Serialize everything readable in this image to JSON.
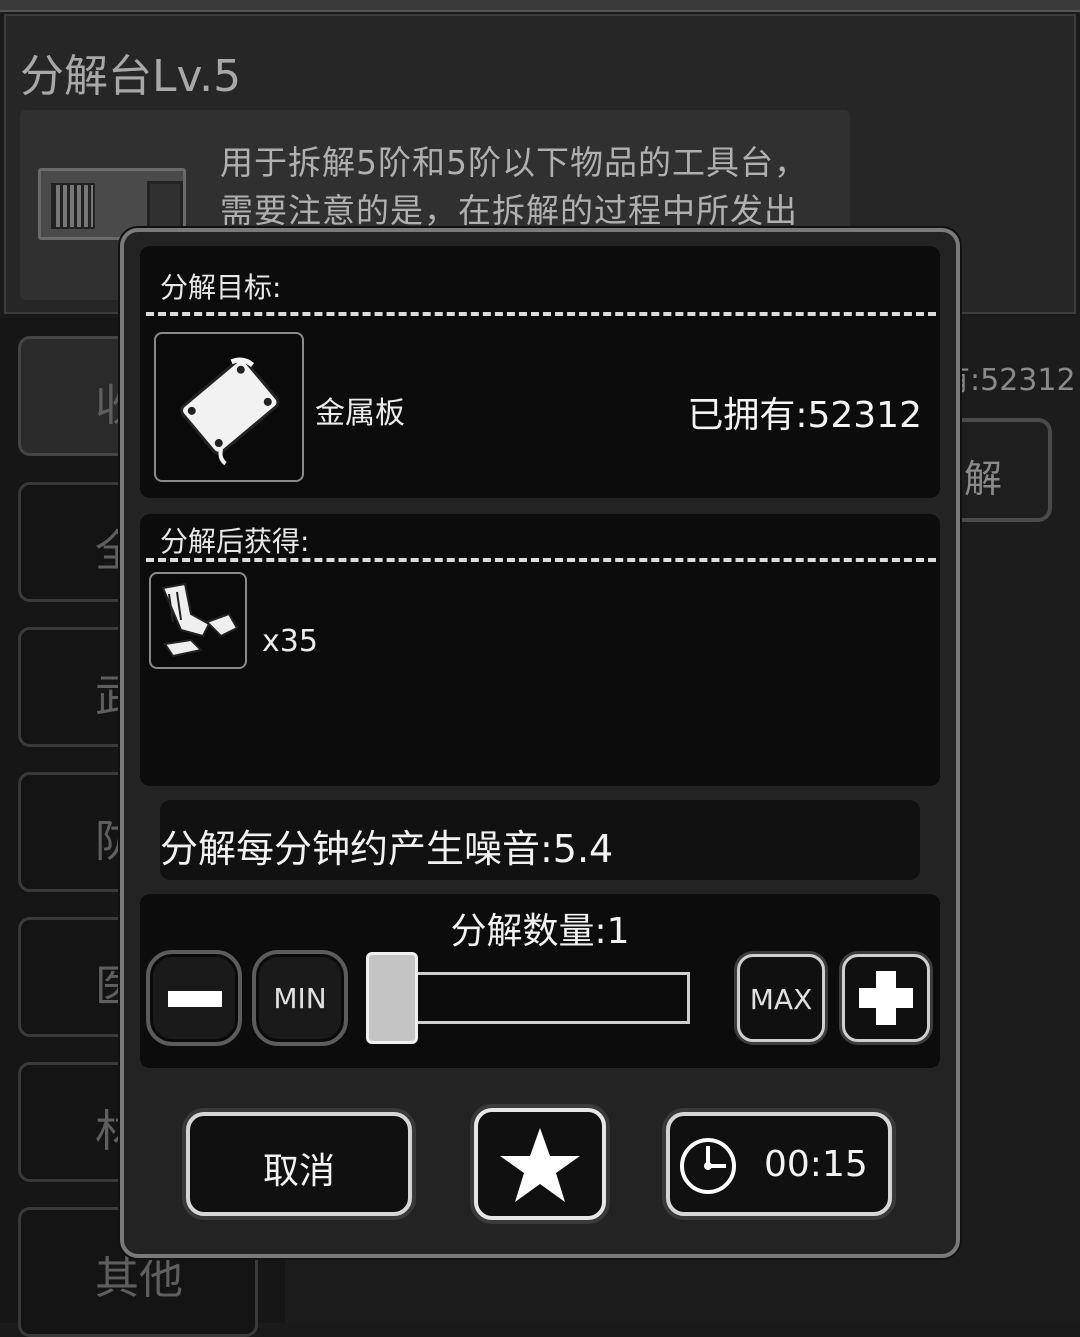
{
  "background": {
    "title": "分解台Lv.5",
    "description_lines": [
      "用于拆解5阶和5阶以下物品的工具台，",
      "需要注意的是，在拆解的过程中所发出"
    ],
    "owned_text": "有:52312",
    "disassemble_button": "解",
    "side_categories": [
      "收",
      "全",
      "武",
      "防",
      "医",
      "材",
      "其他"
    ]
  },
  "modal": {
    "target_header": "分解目标:",
    "target_item": {
      "name": "金属板",
      "owned": "已拥有:52312",
      "icon": "metal-plate-icon"
    },
    "result_header": "分解后获得:",
    "result_item": {
      "count": "x35",
      "icon": "scrap-metal-icon"
    },
    "noise_text": "分解每分钟约产生噪音:5.4",
    "quantity_label": "分解数量:1",
    "quantity": {
      "value": 1,
      "slider_fraction": 0
    },
    "buttons": {
      "minus": "minus-icon",
      "min": "MIN",
      "max": "MAX",
      "plus": "plus-icon",
      "cancel": "取消",
      "favorite": "star-icon",
      "timer": "00:15"
    }
  }
}
